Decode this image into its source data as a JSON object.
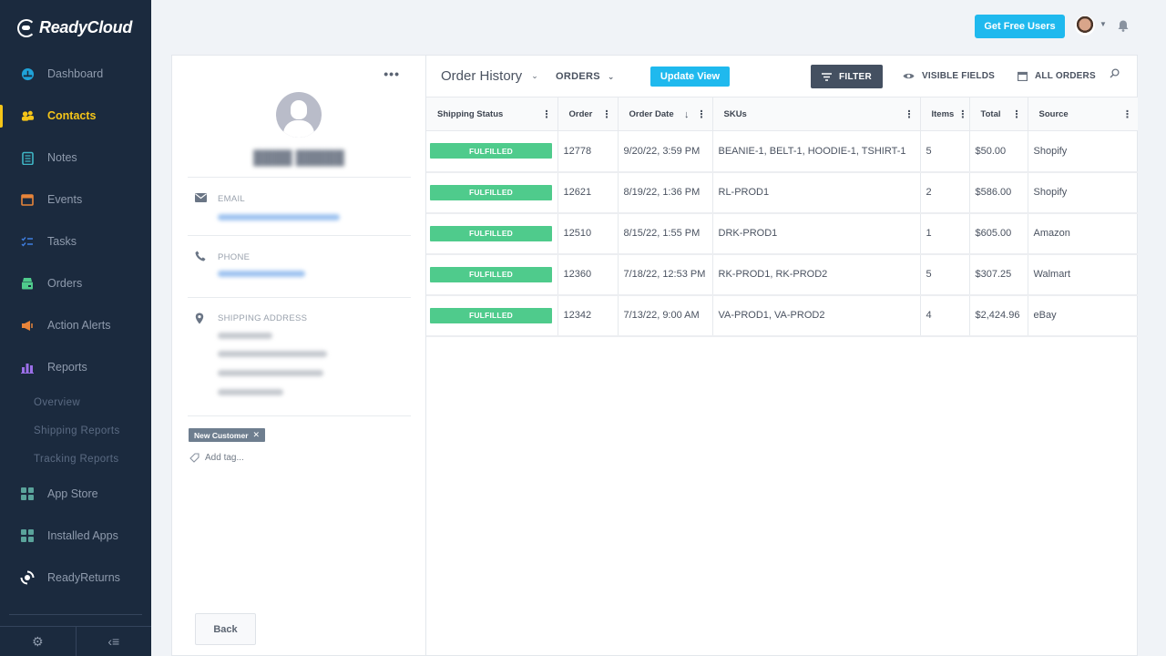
{
  "app": {
    "brand": "ReadyCloud",
    "accent_color": "#1fb9ee",
    "sidebar_color": "#1b2a3e",
    "active_nav_color": "#f5c518",
    "status_fulfilled_color": "#4fcb8c"
  },
  "sidebar": {
    "items": [
      {
        "label": "Dashboard",
        "icon": "dashboard-icon",
        "active": false
      },
      {
        "label": "Contacts",
        "icon": "contacts-icon",
        "active": true
      },
      {
        "label": "Notes",
        "icon": "notes-icon",
        "active": false
      },
      {
        "label": "Events",
        "icon": "calendar-icon",
        "active": false
      },
      {
        "label": "Tasks",
        "icon": "tasks-icon",
        "active": false
      },
      {
        "label": "Orders",
        "icon": "box-icon",
        "active": false
      },
      {
        "label": "Action Alerts",
        "icon": "megaphone-icon",
        "active": false
      },
      {
        "label": "Reports",
        "icon": "bar-chart-icon",
        "active": false
      }
    ],
    "report_subitems": [
      "Overview",
      "Shipping Reports",
      "Tracking Reports"
    ],
    "bottom_items": [
      {
        "label": "App Store",
        "icon": "grid-icon"
      },
      {
        "label": "Installed Apps",
        "icon": "grid-icon"
      },
      {
        "label": "ReadyReturns",
        "icon": "readyreturns-icon"
      }
    ],
    "footer": {
      "settings_icon": "gear-icon",
      "collapse_label": "‹≡"
    }
  },
  "topbar": {
    "get_free_users_label": "Get Free Users",
    "avatar_icon": "user-avatar",
    "notifications_icon": "bell-icon"
  },
  "contact": {
    "more_label": "•••",
    "name_blurred": true,
    "fields": [
      {
        "label": "EMAIL",
        "icon": "envelope-icon",
        "value_blurred": true
      },
      {
        "label": "PHONE",
        "icon": "phone-icon",
        "value_blurred": true
      },
      {
        "label": "SHIPPING ADDRESS",
        "icon": "location-pin-icon",
        "value_blurred": true
      }
    ],
    "tags": [
      {
        "label": "New Customer",
        "remove_label": "✕"
      }
    ],
    "add_tag_placeholder": "Add tag...",
    "back_label": "Back"
  },
  "orders": {
    "view_title": "Order History",
    "object_select": "ORDERS",
    "update_view_label": "Update View",
    "filter_label": "FILTER",
    "visible_fields_label": "VISIBLE FIELDS",
    "date_range_label": "ALL ORDERS",
    "columns": [
      "Shipping Status",
      "Order",
      "Order Date",
      "SKUs",
      "Items",
      "Total",
      "Source"
    ],
    "sorted_column": "Order Date",
    "sort_direction": "descending",
    "rows": [
      {
        "status": "FULFILLED",
        "order": "12778",
        "date": "9/20/22, 3:59 PM",
        "skus": "BEANIE-1, BELT-1, HOODIE-1, TSHIRT-1",
        "items": "5",
        "total": "$50.00",
        "source": "Shopify"
      },
      {
        "status": "FULFILLED",
        "order": "12621",
        "date": "8/19/22, 1:36 PM",
        "skus": "RL-PROD1",
        "items": "2",
        "total": "$586.00",
        "source": "Shopify"
      },
      {
        "status": "FULFILLED",
        "order": "12510",
        "date": "8/15/22, 1:55 PM",
        "skus": "DRK-PROD1",
        "items": "1",
        "total": "$605.00",
        "source": "Amazon"
      },
      {
        "status": "FULFILLED",
        "order": "12360",
        "date": "7/18/22, 12:53 PM",
        "skus": "RK-PROD1, RK-PROD2",
        "items": "5",
        "total": "$307.25",
        "source": "Walmart"
      },
      {
        "status": "FULFILLED",
        "order": "12342",
        "date": "7/13/22, 9:00 AM",
        "skus": "VA-PROD1, VA-PROD2",
        "items": "4",
        "total": "$2,424.96",
        "source": "eBay"
      }
    ]
  }
}
